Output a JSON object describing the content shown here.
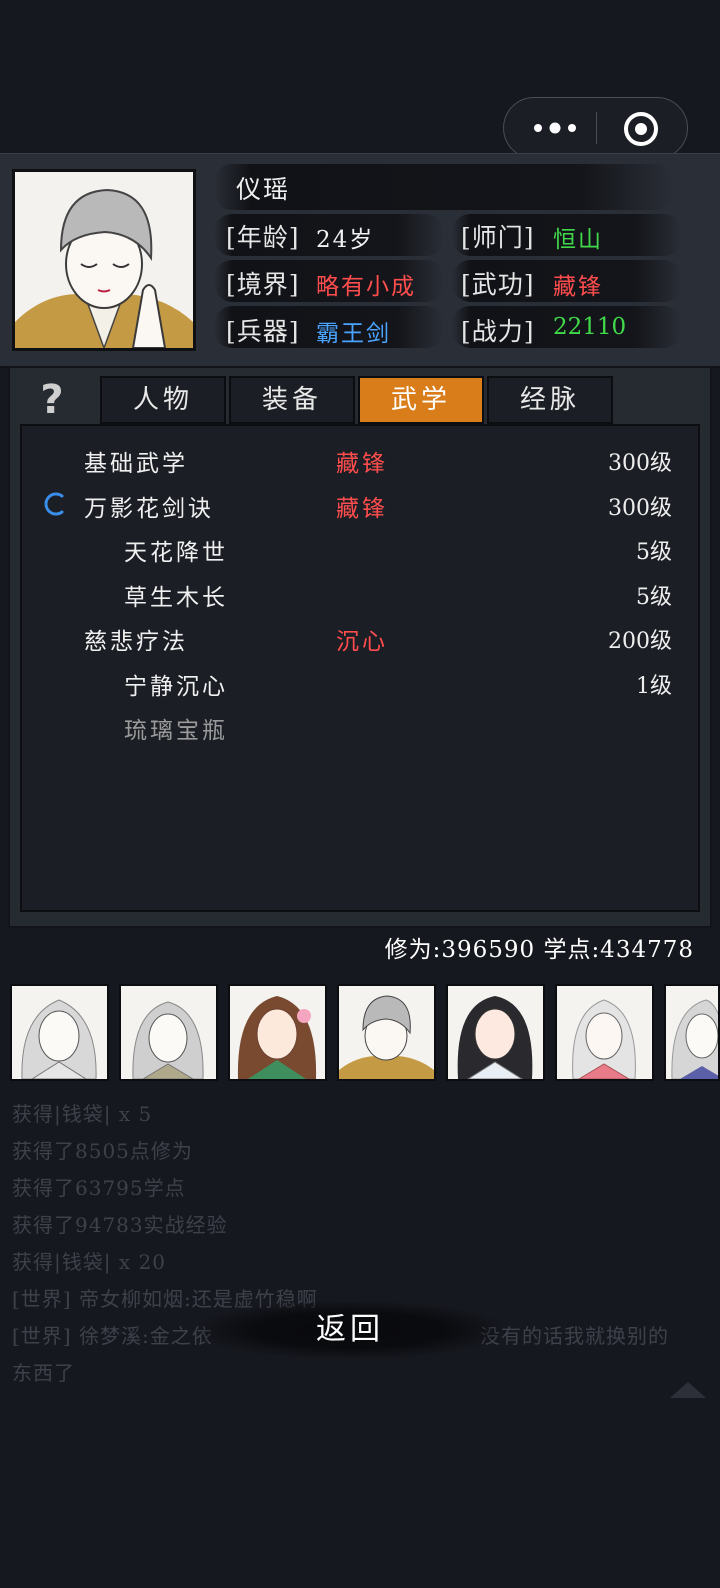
{
  "capsule": {
    "more_icon": "more-dots-icon",
    "close_icon": "target-circle-icon"
  },
  "character": {
    "name": "仪瑶",
    "fields": {
      "age_label": "[年龄]",
      "age_value": "24岁",
      "sect_label": "[师门]",
      "sect_value": "恒山",
      "realm_label": "[境界]",
      "realm_value": "略有小成",
      "martial_label": "[武功]",
      "martial_value": "藏锋",
      "weapon_label": "[兵器]",
      "weapon_value": "霸王剑",
      "power_label": "[战力]",
      "power_value": "22110"
    }
  },
  "tabs": [
    {
      "label": "人物",
      "active": false
    },
    {
      "label": "装备",
      "active": false
    },
    {
      "label": "武学",
      "active": true
    },
    {
      "label": "经脉",
      "active": false
    }
  ],
  "help_icon": "?",
  "skills": [
    {
      "name": "基础武学",
      "style": "藏锋",
      "level": "300级",
      "indent": false,
      "loading": false,
      "dim": false
    },
    {
      "name": "万影花剑诀",
      "style": "藏锋",
      "level": "300级",
      "indent": false,
      "loading": true,
      "dim": false
    },
    {
      "name": "天花降世",
      "style": "",
      "level": "5级",
      "indent": true,
      "loading": false,
      "dim": false
    },
    {
      "name": "草生木长",
      "style": "",
      "level": "5级",
      "indent": true,
      "loading": false,
      "dim": false
    },
    {
      "name": "慈悲疗法",
      "style": "沉心",
      "level": "200级",
      "indent": false,
      "loading": false,
      "dim": false
    },
    {
      "name": "宁静沉心",
      "style": "",
      "level": "1级",
      "indent": true,
      "loading": false,
      "dim": false
    },
    {
      "name": "琉璃宝瓶",
      "style": "",
      "level": "",
      "indent": true,
      "loading": false,
      "dim": true
    }
  ],
  "stats": {
    "text": "修为:396590 学点:434778"
  },
  "log": [
    "获得|钱袋| x 5",
    "获得了8505点修为",
    "获得了63795学点",
    "获得了94783实战经验",
    "获得|钱袋| x 20",
    "[世界] 帝女柳如烟:还是虚竹稳啊",
    "[世界] 徐梦溪:金之依",
    "没有的话我就换别的",
    "东西了"
  ],
  "back_button": {
    "label": "返回"
  },
  "colors": {
    "accent": "#d97d1a",
    "green": "#41d94a",
    "red": "#ff4d4d",
    "blue": "#4aa3ff"
  }
}
